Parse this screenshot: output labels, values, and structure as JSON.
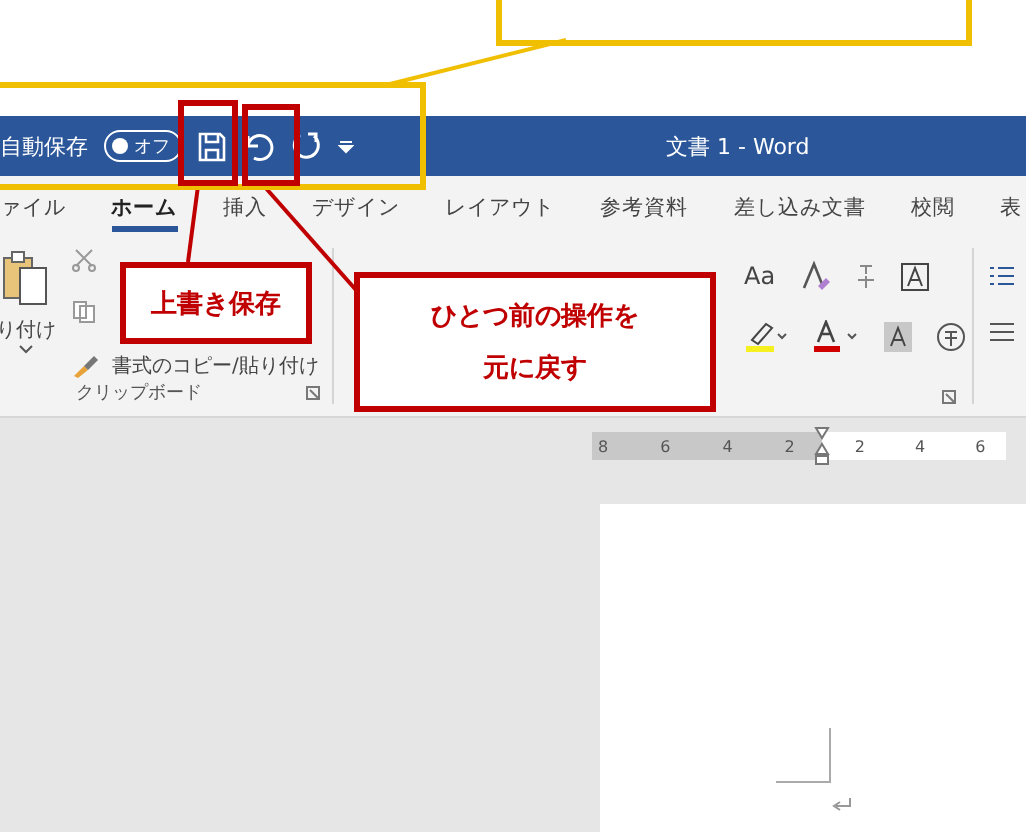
{
  "title_bar": {
    "autosave_label": "自動保存",
    "autosave": {
      "on": false,
      "label": "オフ"
    },
    "title": "文書 1 - Word"
  },
  "tabs": [
    {
      "label": "ァイル",
      "selected": false
    },
    {
      "label": "ホーム",
      "selected": true
    },
    {
      "label": "挿入",
      "selected": false
    },
    {
      "label": "デザイン",
      "selected": false
    },
    {
      "label": "レイアウト",
      "selected": false
    },
    {
      "label": "参考資料",
      "selected": false
    },
    {
      "label": "差し込み文書",
      "selected": false
    },
    {
      "label": "校閲",
      "selected": false
    },
    {
      "label": "表",
      "selected": false
    }
  ],
  "clipboard_group": {
    "paste_label": "り付け",
    "format_painter": "書式のコピー/貼り付け",
    "label": "クリップボード"
  },
  "font_group": {
    "change_case": "Aa"
  },
  "ruler": {
    "left_labels": [
      "8",
      "6",
      "4",
      "2"
    ],
    "right_labels": [
      "2",
      "4",
      "6"
    ]
  },
  "callouts": [
    {
      "kind": "red",
      "lines": [
        "上書き保存"
      ]
    },
    {
      "kind": "red",
      "lines": [
        "ひとつ前の操作を",
        "元に戻す"
      ]
    }
  ]
}
